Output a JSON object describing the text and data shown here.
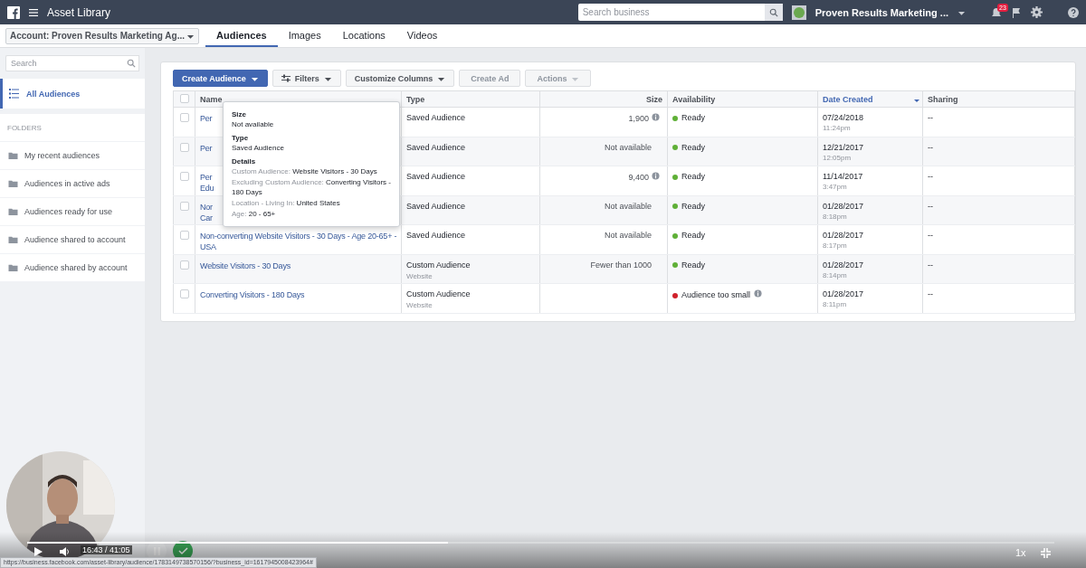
{
  "topbar": {
    "title": "Asset Library",
    "search": {
      "placeholder": "Search business"
    },
    "account": "Proven Results Marketing ...",
    "notification_count": "23"
  },
  "subnav": {
    "account_selector": "Account: Proven Results Marketing Ag...",
    "tabs": [
      {
        "label": "Audiences",
        "selected": true
      },
      {
        "label": "Images",
        "selected": false
      },
      {
        "label": "Locations",
        "selected": false
      },
      {
        "label": "Videos",
        "selected": false
      }
    ]
  },
  "sidebar": {
    "search": {
      "placeholder": "Search"
    },
    "all_audiences": {
      "label": "All Audiences",
      "selected": true
    },
    "folders_heading": "FOLDERS",
    "folders": [
      "My recent audiences",
      "Audiences in active ads",
      "Audiences ready for use",
      "Audience shared to account",
      "Audience shared by account"
    ]
  },
  "toolbar": [
    {
      "label": "Create Audience",
      "kind": "primary",
      "caret": true,
      "disabled": false
    },
    {
      "label": "Filters",
      "kind": "filter",
      "caret": true,
      "disabled": false
    },
    {
      "label": "Customize Columns",
      "kind": "default",
      "caret": true,
      "disabled": false
    },
    {
      "label": "Create Ad",
      "kind": "default",
      "caret": false,
      "disabled": true
    },
    {
      "label": "Actions",
      "kind": "default",
      "caret": true,
      "disabled": true
    }
  ],
  "table": {
    "select_all_checked": false,
    "columns": [
      {
        "label": "Name",
        "sorted": false
      },
      {
        "label": "Type",
        "sorted": false
      },
      {
        "label": "Size",
        "sorted": false
      },
      {
        "label": "Availability",
        "sorted": false
      },
      {
        "label": "Date Created",
        "sorted": true
      },
      {
        "label": "Sharing",
        "sorted": false
      }
    ],
    "rows": [
      {
        "checked": false,
        "name_lines": [
          "Per"
        ],
        "type": "Saved Audience",
        "size": "1,900",
        "size_info": true,
        "availability": "Ready",
        "color": "#5fb037",
        "availability_info": false,
        "date": "07/24/2018",
        "time": "11:24pm",
        "sharing": "--"
      },
      {
        "checked": false,
        "name_lines": [
          "Per"
        ],
        "type": "Saved Audience",
        "size": "Not available",
        "size_info": false,
        "availability": "Ready",
        "color": "#5fb037",
        "availability_info": false,
        "date": "12/21/2017",
        "time": "12:05pm",
        "sharing": "--"
      },
      {
        "checked": false,
        "name_lines": [
          "Per",
          "Edu"
        ],
        "type": "Saved Audience",
        "size": "9,400",
        "size_info": true,
        "availability": "Ready",
        "color": "#5fb037",
        "availability_info": false,
        "date": "11/14/2017",
        "time": "3:47pm",
        "sharing": "--"
      },
      {
        "checked": false,
        "name_lines": [
          "Nor",
          "Car"
        ],
        "type": "Saved Audience",
        "size": "Not available",
        "size_info": false,
        "availability": "Ready",
        "color": "#5fb037",
        "availability_info": false,
        "date": "01/28/2017",
        "time": "8:18pm",
        "sharing": "--"
      },
      {
        "checked": false,
        "name_lines": [
          "Non-converting Website Visitors - 30 Days - Age 20-65+ -",
          "USA"
        ],
        "type": "Saved Audience",
        "size": "Not available",
        "size_info": false,
        "availability": "Ready",
        "color": "#5fb037",
        "availability_info": false,
        "date": "01/28/2017",
        "time": "8:17pm",
        "sharing": "--"
      },
      {
        "checked": false,
        "name_lines": [
          "Website Visitors - 30 Days"
        ],
        "type": "Custom Audience",
        "subtype": "Website",
        "size": "Fewer than 1000",
        "size_info": false,
        "availability": "Ready",
        "color": "#5fb037",
        "availability_info": false,
        "date": "01/28/2017",
        "time": "8:14pm",
        "sharing": "--"
      },
      {
        "checked": false,
        "name_lines": [
          "Converting Visitors - 180 Days"
        ],
        "type": "Custom Audience",
        "subtype": "Website",
        "size_info": false,
        "availability": "Audience too small",
        "color": "#d0212b",
        "availability_info": true,
        "date": "01/28/2017",
        "time": "8:11pm",
        "sharing": "--"
      }
    ]
  },
  "tooltip": {
    "sections": [
      {
        "heading": "Size",
        "lines": [
          {
            "value": "Not available"
          }
        ]
      },
      {
        "heading": "Type",
        "lines": [
          {
            "value": "Saved Audience"
          }
        ]
      },
      {
        "heading": "Details",
        "lines": [
          {
            "label": "Custom Audience:",
            "value": "Website Visitors - 30 Days"
          },
          {
            "label": "Excluding Custom Audience:",
            "value": "Converting Visitors - 180 Days"
          },
          {
            "label": "Location - Living In:",
            "value": "United States"
          },
          {
            "label": "Age:",
            "value": "20 - 65+"
          }
        ]
      }
    ]
  },
  "player": {
    "time": "16:43 / 41:05",
    "speed": "1x",
    "level": 0.41,
    "status_url": "https://business.facebook.com/asset-library/audience/1783149738570156/?business_id=1617945008423964#"
  }
}
